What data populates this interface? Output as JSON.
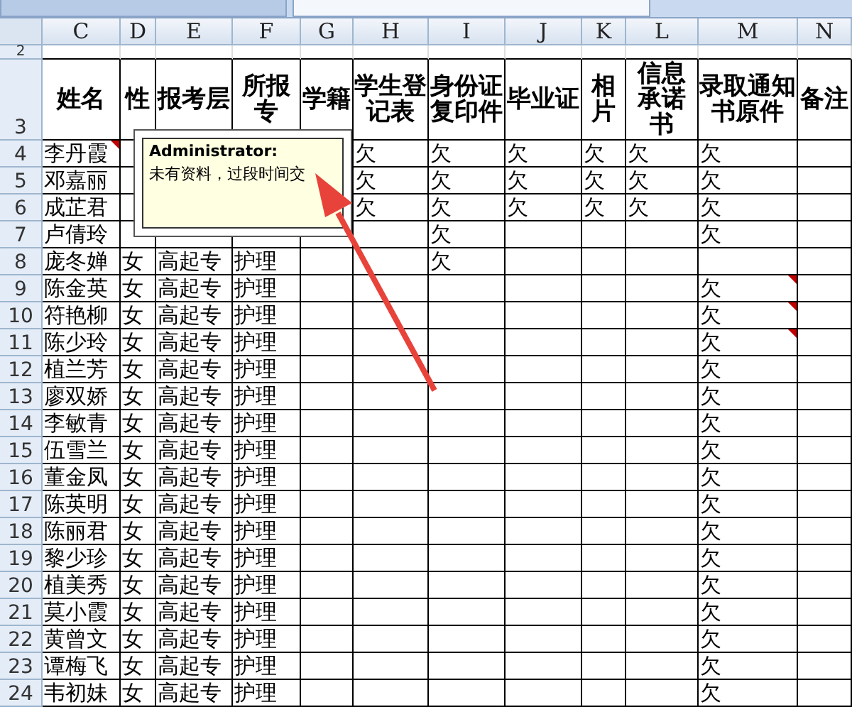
{
  "columns": [
    {
      "letter": "C",
      "heading": "姓名"
    },
    {
      "letter": "D",
      "heading": "性"
    },
    {
      "letter": "E",
      "heading": "报考层"
    },
    {
      "letter": "F",
      "heading": "所报专"
    },
    {
      "letter": "G",
      "heading": "学籍"
    },
    {
      "letter": "H",
      "heading": "学生登记表"
    },
    {
      "letter": "I",
      "heading": "身份证复印件"
    },
    {
      "letter": "J",
      "heading": "毕业证"
    },
    {
      "letter": "K",
      "heading": "相片"
    },
    {
      "letter": "L",
      "heading": "信息承诺书"
    },
    {
      "letter": "M",
      "heading": "录取通知书原件"
    },
    {
      "letter": "N",
      "heading": "备注"
    }
  ],
  "header_rows": [
    "2",
    "3"
  ],
  "rows": [
    {
      "num": "4",
      "cells": {
        "C": "李丹霞",
        "H": "欠",
        "I": "欠",
        "J": "欠",
        "K": "欠",
        "L": "欠",
        "M": "欠"
      },
      "noted": {
        "C": true
      }
    },
    {
      "num": "5",
      "cells": {
        "C": "邓嘉丽",
        "H": "欠",
        "I": "欠",
        "J": "欠",
        "K": "欠",
        "L": "欠",
        "M": "欠"
      }
    },
    {
      "num": "6",
      "cells": {
        "C": "成芷君",
        "H": "欠",
        "I": "欠",
        "J": "欠",
        "K": "欠",
        "L": "欠",
        "M": "欠"
      }
    },
    {
      "num": "7",
      "cells": {
        "C": "卢倩玲",
        "I": "欠",
        "M": "欠"
      }
    },
    {
      "num": "8",
      "cells": {
        "C": "庞冬婵",
        "D": "女",
        "E": "高起专",
        "F": "护理",
        "I": "欠"
      }
    },
    {
      "num": "9",
      "cells": {
        "C": "陈金英",
        "D": "女",
        "E": "高起专",
        "F": "护理",
        "M": "欠"
      },
      "noted": {
        "M": true
      }
    },
    {
      "num": "10",
      "cells": {
        "C": "符艳柳",
        "D": "女",
        "E": "高起专",
        "F": "护理",
        "M": "欠"
      },
      "noted": {
        "M": true
      }
    },
    {
      "num": "11",
      "cells": {
        "C": "陈少玲",
        "D": "女",
        "E": "高起专",
        "F": "护理",
        "M": "欠"
      },
      "noted": {
        "M": true
      }
    },
    {
      "num": "12",
      "cells": {
        "C": "植兰芳",
        "D": "女",
        "E": "高起专",
        "F": "护理",
        "M": "欠"
      }
    },
    {
      "num": "13",
      "cells": {
        "C": "廖双娇",
        "D": "女",
        "E": "高起专",
        "F": "护理",
        "M": "欠"
      }
    },
    {
      "num": "14",
      "cells": {
        "C": "李敏青",
        "D": "女",
        "E": "高起专",
        "F": "护理",
        "M": "欠"
      }
    },
    {
      "num": "15",
      "cells": {
        "C": "伍雪兰",
        "D": "女",
        "E": "高起专",
        "F": "护理",
        "M": "欠"
      }
    },
    {
      "num": "16",
      "cells": {
        "C": "董金凤",
        "D": "女",
        "E": "高起专",
        "F": "护理",
        "M": "欠"
      }
    },
    {
      "num": "17",
      "cells": {
        "C": "陈英明",
        "D": "女",
        "E": "高起专",
        "F": "护理",
        "M": "欠"
      }
    },
    {
      "num": "18",
      "cells": {
        "C": "陈丽君",
        "D": "女",
        "E": "高起专",
        "F": "护理",
        "M": "欠"
      }
    },
    {
      "num": "19",
      "cells": {
        "C": "黎少珍",
        "D": "女",
        "E": "高起专",
        "F": "护理",
        "M": "欠"
      }
    },
    {
      "num": "20",
      "cells": {
        "C": "植美秀",
        "D": "女",
        "E": "高起专",
        "F": "护理",
        "M": "欠"
      }
    },
    {
      "num": "21",
      "cells": {
        "C": "莫小霞",
        "D": "女",
        "E": "高起专",
        "F": "护理",
        "M": "欠"
      }
    },
    {
      "num": "22",
      "cells": {
        "C": "黄曾文",
        "D": "女",
        "E": "高起专",
        "F": "护理",
        "M": "欠"
      }
    },
    {
      "num": "23",
      "cells": {
        "C": "谭梅飞",
        "D": "女",
        "E": "高起专",
        "F": "护理",
        "M": "欠"
      }
    },
    {
      "num": "24",
      "cells": {
        "C": "韦初妹",
        "D": "女",
        "E": "高起专",
        "F": "护理",
        "M": "欠"
      }
    }
  ],
  "comment": {
    "author": "Administrator:",
    "text": "未有资料，过段时间交"
  }
}
